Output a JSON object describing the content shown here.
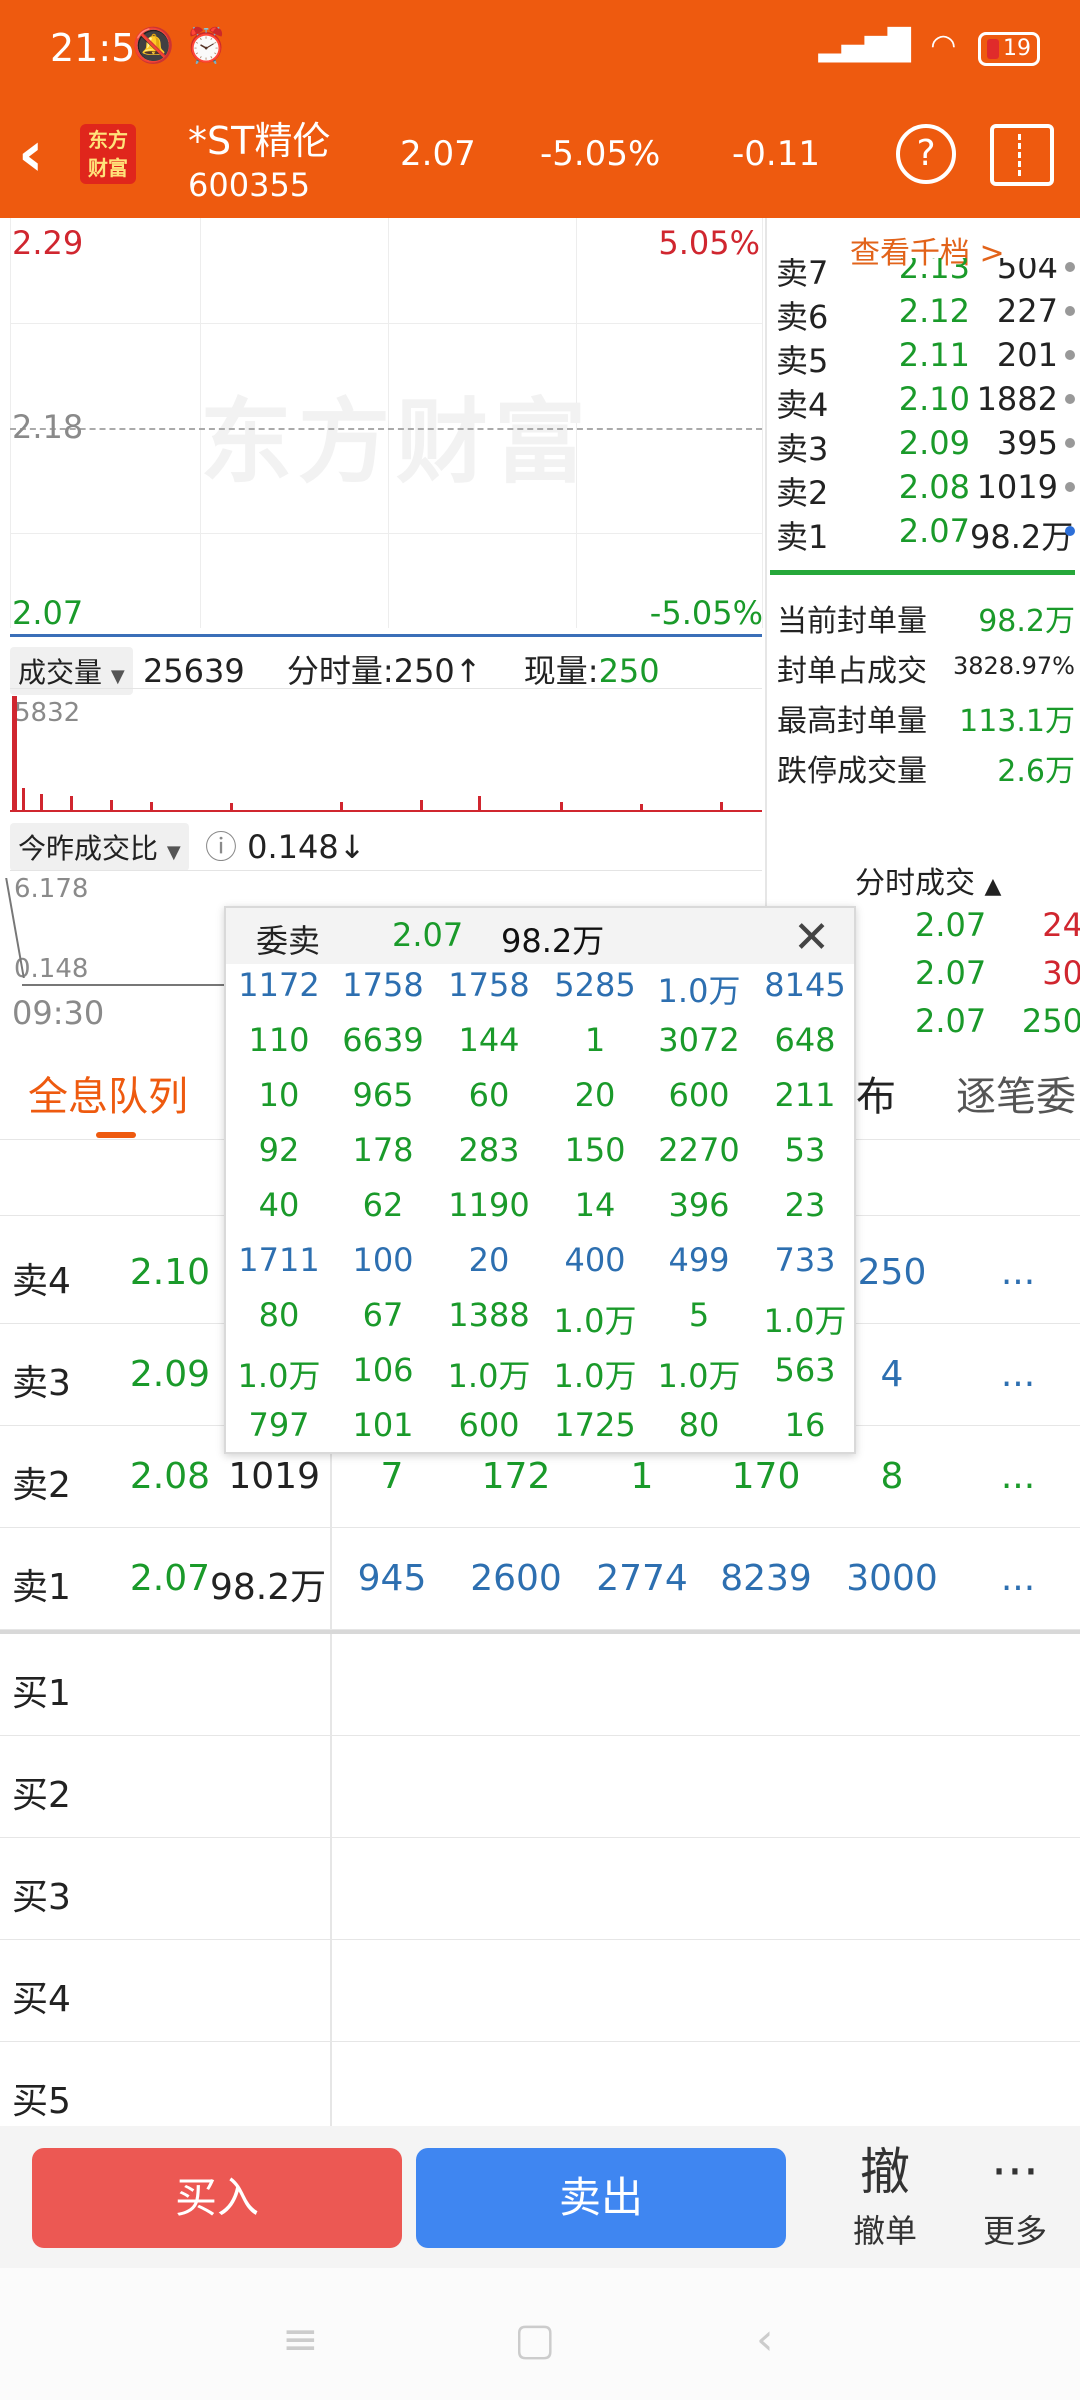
{
  "status": {
    "time": "21:54",
    "battery": "19"
  },
  "header": {
    "logo_line1": "东方",
    "logo_line2": "财富",
    "stock_name": "*ST精伦",
    "stock_code": "600355",
    "price": "2.07",
    "pct_change": "-5.05%",
    "change": "-0.11"
  },
  "chart": {
    "top_price": "2.29",
    "top_pct": "5.05%",
    "mid_price": "2.18",
    "bottom_price": "2.07",
    "bottom_pct": "-5.05%",
    "watermark": "东方财富",
    "start_time": "09:30",
    "volume": {
      "selector": "成交量",
      "total": "25639",
      "period_label": "分时量:",
      "period_value": "250",
      "now_label": "现量:",
      "now_value": "250",
      "max_label": "5832"
    },
    "ratio": {
      "selector": "今昨成交比",
      "value": "0.148",
      "top_label": "6.178",
      "bottom_label": "0.148"
    }
  },
  "right_panel": {
    "view_more": "查看千档 >",
    "asks": [
      {
        "label": "卖7",
        "price": "2.13",
        "vol": "504"
      },
      {
        "label": "卖6",
        "price": "2.12",
        "vol": "227"
      },
      {
        "label": "卖5",
        "price": "2.11",
        "vol": "201"
      },
      {
        "label": "卖4",
        "price": "2.10",
        "vol": "1882"
      },
      {
        "label": "卖3",
        "price": "2.09",
        "vol": "395"
      },
      {
        "label": "卖2",
        "price": "2.08",
        "vol": "1019"
      },
      {
        "label": "卖1",
        "price": "2.07",
        "vol": "98.2万"
      }
    ],
    "seal": [
      {
        "label": "当前封单量",
        "value": "98.2万"
      },
      {
        "label": "封单占成交",
        "value": "3828.97%"
      },
      {
        "label": "最高封单量",
        "value": "113.1万"
      },
      {
        "label": "跌停成交量",
        "value": "2.6万"
      }
    ],
    "ticks_title": "分时成交",
    "ticks": [
      {
        "price": "2.07",
        "vol": "24"
      },
      {
        "price": "2.07",
        "vol": "30"
      },
      {
        "price": "2.07",
        "vol": "250"
      }
    ]
  },
  "tabs": [
    {
      "label": "全息队列"
    },
    {
      "label": "布"
    },
    {
      "label": "逐笔委"
    }
  ],
  "queue": {
    "rows": [
      {
        "label": "卖4",
        "price": "2.10",
        "vol": "",
        "cells": [
          "",
          "",
          "",
          "",
          "250",
          "..."
        ]
      },
      {
        "label": "卖3",
        "price": "2.09",
        "vol": "",
        "cells": [
          "",
          "",
          "",
          "",
          "4",
          "..."
        ]
      },
      {
        "label": "卖2",
        "price": "2.08",
        "vol": "1019",
        "cells": [
          "7",
          "172",
          "1",
          "170",
          "8",
          "..."
        ]
      },
      {
        "label": "卖1",
        "price": "2.07",
        "vol": "98.2万",
        "cells": [
          "945",
          "2600",
          "2774",
          "8239",
          "3000",
          "..."
        ]
      },
      {
        "label": "买1"
      },
      {
        "label": "买2"
      },
      {
        "label": "买3"
      },
      {
        "label": "买4"
      },
      {
        "label": "买5"
      }
    ]
  },
  "popup": {
    "title": "委卖",
    "price": "2.07",
    "volume": "98.2万",
    "grid": [
      [
        "1172",
        "1758",
        "1758",
        "5285",
        "1.0万",
        "8145"
      ],
      [
        "110",
        "6639",
        "144",
        "1",
        "3072",
        "648"
      ],
      [
        "10",
        "965",
        "60",
        "20",
        "600",
        "211"
      ],
      [
        "92",
        "178",
        "283",
        "150",
        "2270",
        "53"
      ],
      [
        "40",
        "62",
        "1190",
        "14",
        "396",
        "23"
      ],
      [
        "1711",
        "100",
        "20",
        "400",
        "499",
        "733"
      ],
      [
        "80",
        "67",
        "1388",
        "1.0万",
        "5",
        "1.0万"
      ],
      [
        "1.0万",
        "106",
        "1.0万",
        "1.0万",
        "1.0万",
        "563"
      ],
      [
        "797",
        "101",
        "600",
        "1725",
        "80",
        "16"
      ]
    ]
  },
  "actions": {
    "buy": "买入",
    "sell": "卖出",
    "cancel_icon": "撤",
    "cancel_label": "撤单",
    "more_icon": "···",
    "more_label": "更多"
  }
}
